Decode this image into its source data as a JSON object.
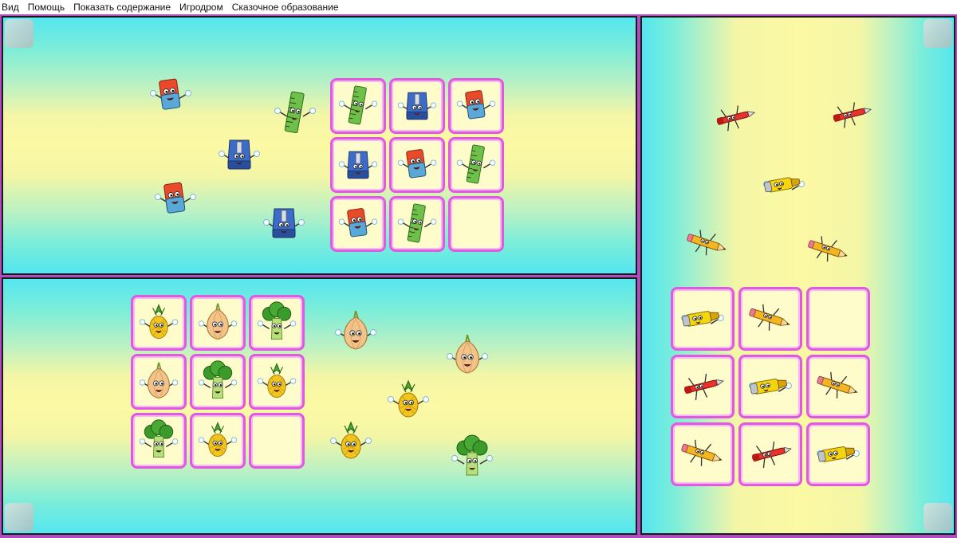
{
  "menu": {
    "items": [
      "Вид",
      "Помощь",
      "Показать содержание",
      "Игродром",
      "Сказочное образование"
    ]
  },
  "colors": {
    "cell_border": "#e05ae0",
    "cell_fill": "#fffccc",
    "window_frame": "#b04bc0"
  },
  "puzzles": [
    {
      "id": "stationery",
      "grid": [
        [
          "ruler-icon",
          "sharpener-blue-icon",
          "eraser-icon"
        ],
        [
          "sharpener-blue-icon",
          "eraser-icon",
          "ruler-icon"
        ],
        [
          "eraser-icon",
          "ruler-icon",
          "empty"
        ]
      ],
      "loose_pieces": [
        "eraser-icon",
        "ruler-icon",
        "sharpener-blue-icon",
        "eraser-icon",
        "sharpener-blue-icon"
      ]
    },
    {
      "id": "vegetables",
      "grid": [
        [
          "pineapple-icon",
          "onion-icon",
          "broccoli-icon"
        ],
        [
          "onion-icon",
          "broccoli-icon",
          "pineapple-icon"
        ],
        [
          "broccoli-icon",
          "pineapple-icon",
          "empty"
        ]
      ],
      "loose_pieces": [
        "onion-icon",
        "onion-icon",
        "pineapple-icon",
        "pineapple-icon",
        "broccoli-icon"
      ]
    },
    {
      "id": "pens",
      "grid": [
        [
          "highlighter-icon",
          "pencil-icon",
          "empty"
        ],
        [
          "red-pen-icon",
          "highlighter-icon",
          "pencil-icon"
        ],
        [
          "pencil-icon",
          "red-pen-icon",
          "highlighter-icon"
        ]
      ],
      "loose_pieces": [
        "red-pen-icon",
        "red-pen-icon",
        "highlighter-icon",
        "pencil-icon",
        "pencil-icon"
      ]
    }
  ]
}
